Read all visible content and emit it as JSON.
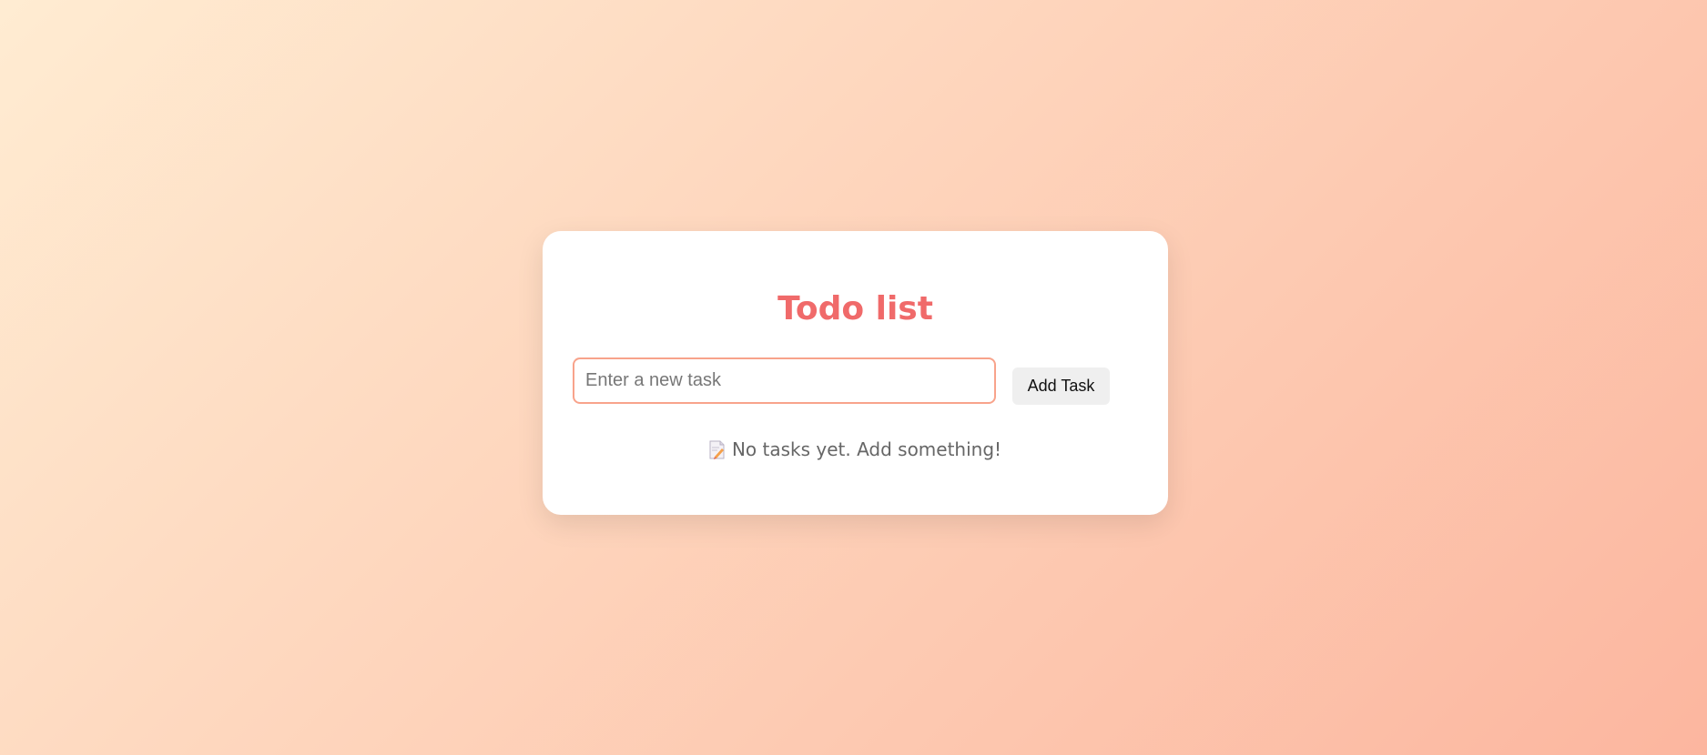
{
  "card": {
    "title": "Todo list",
    "input": {
      "placeholder": "Enter a new task",
      "value": ""
    },
    "add_button_label": "Add Task",
    "empty_state": {
      "icon": "memo-icon",
      "text": "No tasks yet. Add something!"
    }
  },
  "colors": {
    "title": "#f06a6a",
    "input_border": "#f8a38b",
    "button_bg": "#efefef",
    "background_start": "#ffecd2",
    "background_end": "#fcb69f"
  }
}
